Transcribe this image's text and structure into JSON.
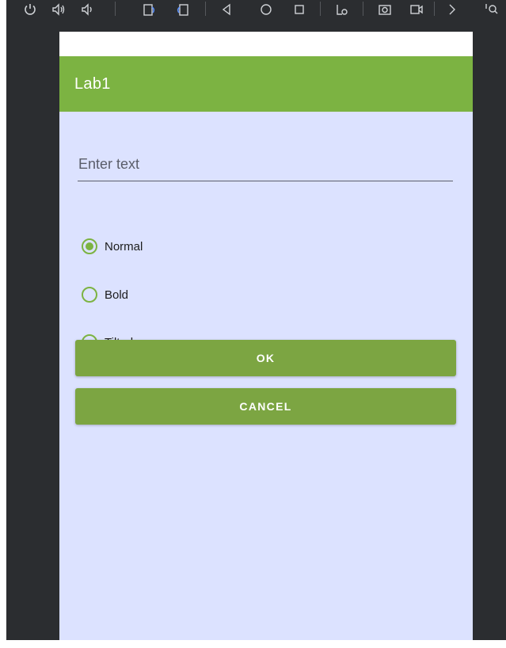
{
  "app_bar": {
    "title": "Lab1"
  },
  "input": {
    "placeholder": "Enter text",
    "value": ""
  },
  "radio_group": {
    "options": [
      {
        "label": "Normal",
        "selected": true
      },
      {
        "label": "Bold",
        "selected": false
      },
      {
        "label": "Tilted",
        "selected": false
      }
    ]
  },
  "buttons": {
    "ok_label": "OK",
    "cancel_label": "CANCEL"
  },
  "toolbar": {
    "icons": [
      "power-icon",
      "volume-up-icon",
      "volume-down-icon",
      "rotate-left-icon",
      "rotate-right-icon",
      "back-icon",
      "home-icon",
      "overview-icon",
      "settings-icon",
      "screenshot-icon",
      "screen-record-icon",
      "more-icon",
      "zoom-icon"
    ]
  },
  "colors": {
    "accent": "#7cb342",
    "button": "#7ca542",
    "screen_background": "#dce2ff",
    "frame": "#2b2d30"
  }
}
